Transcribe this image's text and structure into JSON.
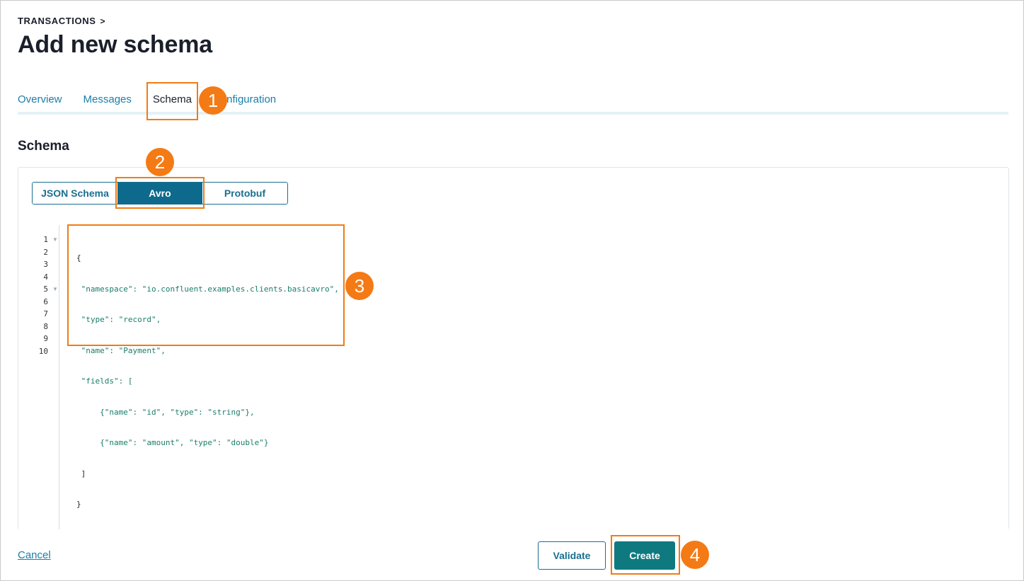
{
  "breadcrumb": {
    "label": "TRANSACTIONS",
    "chevron": ">"
  },
  "page_title": "Add new schema",
  "tabs": [
    {
      "label": "Overview"
    },
    {
      "label": "Messages"
    },
    {
      "label": "Schema"
    },
    {
      "label": "Configuration"
    }
  ],
  "active_tab": "Schema",
  "section_title": "Schema",
  "schema_types": [
    {
      "label": "JSON Schema"
    },
    {
      "label": "Avro"
    },
    {
      "label": "Protobuf"
    }
  ],
  "selected_schema_type": "Avro",
  "editor": {
    "line_numbers": [
      "1",
      "2",
      "3",
      "4",
      "5",
      "6",
      "7",
      "8",
      "9",
      "10"
    ],
    "lines": [
      "{",
      " \"namespace\": \"io.confluent.examples.clients.basicavro\",",
      " \"type\": \"record\",",
      " \"name\": \"Payment\",",
      " \"fields\": [",
      "     {\"name\": \"id\", \"type\": \"string\"},",
      "     {\"name\": \"amount\", \"type\": \"double\"}",
      " ]",
      "}",
      ""
    ]
  },
  "annotations": [
    "1",
    "2",
    "3",
    "4"
  ],
  "footer": {
    "cancel_label": "Cancel",
    "validate_label": "Validate",
    "create_label": "Create"
  },
  "colors": {
    "accent": "#1a6f8f",
    "primary_button": "#0e7a80",
    "link": "#1a7ea8",
    "annotation": "#f47a15"
  }
}
